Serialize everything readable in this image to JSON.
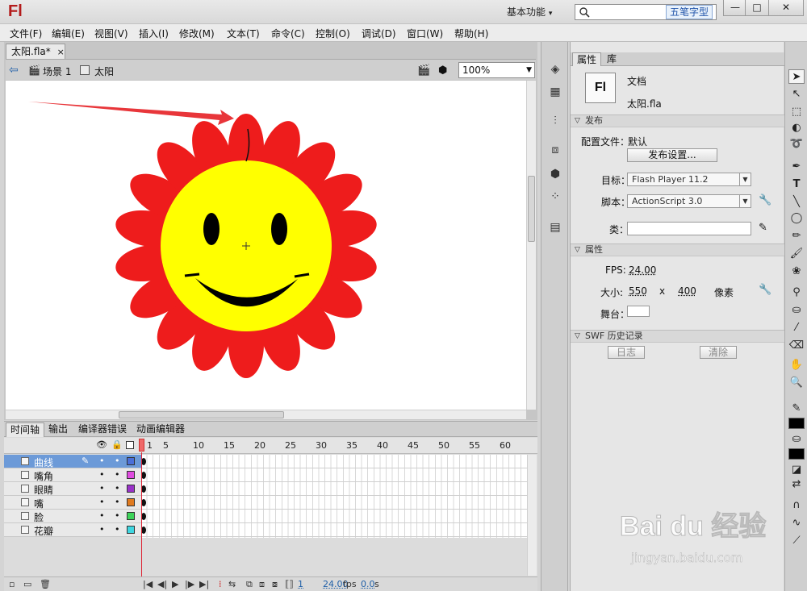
{
  "app": {
    "logo": "Fl",
    "workspace": "基本功能",
    "ime_badge": "五笔字型"
  },
  "window_controls": {
    "minimize": "—",
    "maximize": "□",
    "close": "✕"
  },
  "menu": [
    "文件(F)",
    "编辑(E)",
    "视图(V)",
    "插入(I)",
    "修改(M)",
    "文本(T)",
    "命令(C)",
    "控制(O)",
    "调试(D)",
    "窗口(W)",
    "帮助(H)"
  ],
  "document": {
    "tab_label": "太阳.fla*",
    "tab_close": "×",
    "breadcrumb_scene": "场景 1",
    "breadcrumb_symbol": "太阳",
    "zoom": "100%"
  },
  "timeline": {
    "tabs": [
      "时间轴",
      "输出",
      "编译器错误",
      "动画编辑器"
    ],
    "frame_numbers": [
      "1",
      "5",
      "10",
      "15",
      "20",
      "25",
      "30",
      "35",
      "40",
      "45",
      "50",
      "55",
      "60"
    ],
    "layers": [
      {
        "name": "曲线",
        "color": "#4a6fd8",
        "selected": true
      },
      {
        "name": "嘴角",
        "color": "#e04ce0",
        "selected": false
      },
      {
        "name": "眼睛",
        "color": "#9a33c9",
        "selected": false
      },
      {
        "name": "嘴",
        "color": "#e07a1f",
        "selected": false
      },
      {
        "name": "脸",
        "color": "#3ed45a",
        "selected": false
      },
      {
        "name": "花瓣",
        "color": "#3fd6e0",
        "selected": false
      }
    ],
    "current_frame": "1",
    "fps": "24.00",
    "fps_unit": "fps",
    "time": "0.0",
    "time_unit": "s"
  },
  "properties": {
    "tabs": [
      "属性",
      "库"
    ],
    "doc_type": "文档",
    "file_name": "太阳.fla",
    "publish": {
      "section": "发布",
      "profile_label": "配置文件：",
      "profile_value": "默认",
      "settings_button": "发布设置...",
      "target_label": "目标：",
      "target_value": "Flash Player 11.2",
      "script_label": "脚本：",
      "script_value": "ActionScript 3.0",
      "class_label": "类："
    },
    "attributes": {
      "section": "属性",
      "fps_label": "FPS:",
      "fps_value": "24.00",
      "size_label": "大小:",
      "width": "550",
      "x": "x",
      "height": "400",
      "unit": "像素",
      "stage_label": "舞台："
    },
    "swf_history": {
      "section": "SWF 历史记录",
      "log_button": "日志",
      "clear_button": "清除"
    }
  },
  "watermark": {
    "line1": "Bai du 经验",
    "line2": "jingyan.baidu.com"
  },
  "colors": {
    "petal": "#ee1c1c",
    "face": "#ffff00",
    "arrow": "#e8363a",
    "stroke_swatch": "#000000",
    "fill_swatch": "#000000"
  }
}
